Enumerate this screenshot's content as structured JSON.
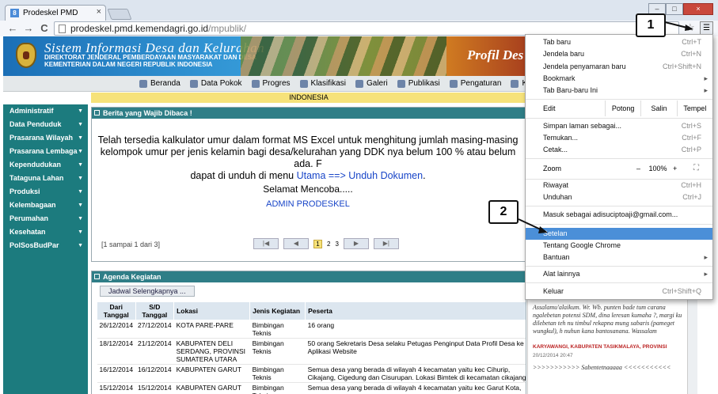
{
  "browser": {
    "tab_title": "Prodeskel PMD",
    "tab_close": "×",
    "favicon_letter": "8",
    "url_host": "prodeskel.pmd.kemendagri.go.id",
    "url_path": "/mpublik/",
    "win_min": "–",
    "win_max": "□",
    "win_close": "×",
    "back": "←",
    "forward": "→",
    "reload": "C",
    "star": "☆",
    "menu": "☰"
  },
  "banner": {
    "title": "Sistem Informasi Desa dan Kelurahan",
    "sub1": "Direktorat Jenderal Pemberdayaan Masyarakat dan Desa",
    "sub2": "Kementerian Dalam Negeri Republik Indonesia",
    "profil": "Profil Des"
  },
  "topnav": [
    "Beranda",
    "Data Pokok",
    "Progres",
    "Klasifikasi",
    "Galeri",
    "Publikasi",
    "Pengaturan",
    "Kon"
  ],
  "country": "INDONESIA",
  "sidebar": [
    "Administratif",
    "Data Penduduk",
    "Prasarana Wilayah",
    "Prasarana Lembaga",
    "Kependudukan",
    "Tataguna Lahan",
    "Produksi",
    "Kelembagaan",
    "Perumahan",
    "Kesehatan",
    "PolSosBudPar"
  ],
  "sidebar_arrow": "▼",
  "berita": {
    "title": "Berita yang Wajib Dibaca !",
    "line1": "Telah tersedia kalkulator umur dalam format MS Excel untuk menghitung jumlah masing-masing",
    "line2": "kelompok umur per jenis kelamin bagi desa/kelurahan yang DDK nya belum 100 % atau belum ada.  F",
    "line3_pre": "dapat di unduh di menu ",
    "line3_link": "Utama ==> Unduh Dokumen",
    "line3_post": ".",
    "greeting": "Selamat Mencoba.....",
    "admin": "ADMIN PRODESKEL",
    "page_count": "[1 sampai 1 dari 3]",
    "pager": {
      "first": "|◀",
      "prev": "◀",
      "p1": "1",
      "p2": "2",
      "p3": "3",
      "next": "▶",
      "last": "▶|"
    }
  },
  "agenda": {
    "title": "Agenda Kegiatan",
    "jadwal_button": "Jadwal Selengkapnya ...",
    "headers": [
      "Dari Tanggal",
      "S/D Tanggal",
      "Lokasi",
      "Jenis Kegiatan",
      "Peserta"
    ],
    "rows": [
      [
        "26/12/2014",
        "27/12/2014",
        "KOTA PARE-PARE",
        "Bimbingan Teknis",
        "16 orang"
      ],
      [
        "18/12/2014",
        "21/12/2014",
        "KABUPATEN DELI SERDANG, PROVINSI SUMATERA UTARA",
        "Bimbingan Teknis",
        "50 orang Sekretaris Desa selaku Petugas Penginput Data Profil Desa ke Aplikasi Website"
      ],
      [
        "16/12/2014",
        "16/12/2014",
        "KABUPATEN GARUT",
        "Bimbingan Teknis",
        "Semua desa yang berada di wilayah 4 kecamatan yaitu kec Cihurip, Cikajang, Cigedung dan Cisurupan. Lokasi Bimtek di kecamatan cikajang"
      ],
      [
        "15/12/2014",
        "15/12/2014",
        "KABUPATEN GARUT",
        "Bimbingan Teknis",
        "Semua desa yang berada di wilayah 4 kecamatan yaitu kec Garut Kota,"
      ]
    ]
  },
  "comment": {
    "text": "Assalamu'alaikum. Wr. Wb. punten bade tum carana ngalebetan potensi SDM, dina leresan kumaha ?, margi ku dilebetan teh nu timbul rekapna mung sabaris (pameget wungkul), h nuhun kana bantosanana. Wassalam",
    "place": "KARYAWANGI, KABUPATEN TASIKMALAYA, PROVINSI",
    "date": "20/12/2014 20:47",
    "text2": ">>>>>>>>>>> Sabentetnaaaaa <<<<<<<<<<<"
  },
  "chrome_menu": {
    "tab_baru": "Tab baru",
    "tab_baru_sc": "Ctrl+T",
    "jendela_baru": "Jendela baru",
    "jendela_baru_sc": "Ctrl+N",
    "jendela_penyamaran": "Jendela penyamaran baru",
    "jendela_penyamaran_sc": "Ctrl+Shift+N",
    "bookmark": "Bookmark",
    "tab_baru_baru": "Tab Baru-baru Ini",
    "edit": "Edit",
    "potong": "Potong",
    "salin": "Salin",
    "tempel": "Tempel",
    "simpan": "Simpan laman sebagai...",
    "simpan_sc": "Ctrl+S",
    "temukan": "Temukan...",
    "temukan_sc": "Ctrl+F",
    "cetak": "Cetak...",
    "cetak_sc": "Ctrl+P",
    "zoom": "Zoom",
    "zoom_minus": "–",
    "zoom_value": "100%",
    "zoom_plus": "+",
    "fullscreen": "⛶",
    "riwayat": "Riwayat",
    "riwayat_sc": "Ctrl+H",
    "unduhan": "Unduhan",
    "unduhan_sc": "Ctrl+J",
    "masuk": "Masuk sebagai adisuciptoaji@gmail.com...",
    "setelan": "Setelan",
    "tentang": "Tentang Google Chrome",
    "bantuan": "Bantuan",
    "alat": "Alat lainnya",
    "keluar": "Keluar",
    "keluar_sc": "Ctrl+Shift+Q",
    "chevron": "▸"
  },
  "callouts": {
    "one": "1",
    "two": "2"
  }
}
